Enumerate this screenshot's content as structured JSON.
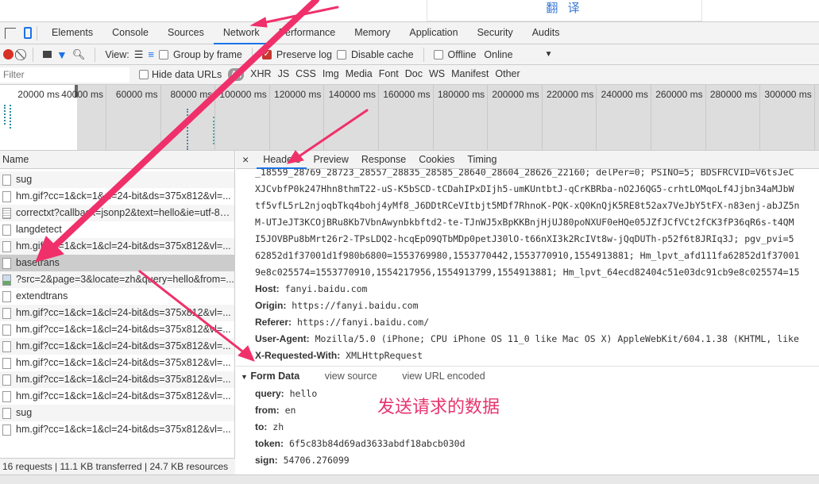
{
  "page": {
    "translate_button": "翻 译"
  },
  "tabs": [
    "Elements",
    "Console",
    "Sources",
    "Network",
    "Performance",
    "Memory",
    "Application",
    "Security",
    "Audits"
  ],
  "active_tab": "Network",
  "toolbar": {
    "view_label": "View:",
    "group_by_frame": "Group by frame",
    "preserve_log": "Preserve log",
    "disable_cache": "Disable cache",
    "offline": "Offline",
    "throttle": "Online"
  },
  "filterbar": {
    "placeholder": "Filter",
    "hide_data_urls": "Hide data URLs",
    "types": [
      "All",
      "XHR",
      "JS",
      "CSS",
      "Img",
      "Media",
      "Font",
      "Doc",
      "WS",
      "Manifest",
      "Other"
    ]
  },
  "overview": {
    "ticks": [
      "20000 ms",
      "40000 ms",
      "60000 ms",
      "80000 ms",
      "100000 ms",
      "120000 ms",
      "140000 ms",
      "160000 ms",
      "180000 ms",
      "200000 ms",
      "220000 ms",
      "240000 ms",
      "260000 ms",
      "280000 ms",
      "300000 ms",
      "3"
    ]
  },
  "requests": {
    "header": "Name",
    "items": [
      {
        "name": "sug",
        "icon": "file"
      },
      {
        "name": "hm.gif?cc=1&ck=1&cl=24-bit&ds=375x812&vl=...",
        "icon": "file"
      },
      {
        "name": "correctxt?callback=jsonp2&text=hello&ie=utf-8&...",
        "icon": "doc"
      },
      {
        "name": "langdetect",
        "icon": "file"
      },
      {
        "name": "hm.gif?cc=1&ck=1&cl=24-bit&ds=375x812&vl=...",
        "icon": "file"
      },
      {
        "name": "basetrans",
        "icon": "file",
        "selected": true
      },
      {
        "name": "?src=2&page=3&locate=zh&query=hello&from=...",
        "icon": "img"
      },
      {
        "name": "extendtrans",
        "icon": "file"
      },
      {
        "name": "hm.gif?cc=1&ck=1&cl=24-bit&ds=375x812&vl=...",
        "icon": "file"
      },
      {
        "name": "hm.gif?cc=1&ck=1&cl=24-bit&ds=375x812&vl=...",
        "icon": "file"
      },
      {
        "name": "hm.gif?cc=1&ck=1&cl=24-bit&ds=375x812&vl=...",
        "icon": "file"
      },
      {
        "name": "hm.gif?cc=1&ck=1&cl=24-bit&ds=375x812&vl=...",
        "icon": "file"
      },
      {
        "name": "hm.gif?cc=1&ck=1&cl=24-bit&ds=375x812&vl=...",
        "icon": "file"
      },
      {
        "name": "hm.gif?cc=1&ck=1&cl=24-bit&ds=375x812&vl=...",
        "icon": "file"
      },
      {
        "name": "sug",
        "icon": "file"
      },
      {
        "name": "hm.gif?cc=1&ck=1&cl=24-bit&ds=375x812&vl=...",
        "icon": "file"
      }
    ]
  },
  "status": "16 requests | 11.1 KB transferred | 24.7 KB resources",
  "detail": {
    "close": "×",
    "tabs": [
      "Headers",
      "Preview",
      "Response",
      "Cookies",
      "Timing"
    ],
    "active_tab": "Headers",
    "cookie_lines": [
      "_18559_28769_28723_28557_28835_28585_28640_28604_28626_22160; delPer=0; PSINO=5; BDSFRCVID=V6tsJeC",
      "XJCvbfP0k247Hhn8thmT22-uS-K5bSCD-tCDahIPxDIjh5-umKUntbtJ-qCrKBRba-nO2J6QG5-crhtLOMqoLf4Jjbn34aMJbW",
      "tf5vfL5rL2njoqbTkq4bohj4yMf8_J6DDtRCeVItbjt5MDf7RhnoK-PQK-xQ0KnQjK5RE8t52ax7VeJbY5tFX-n83enj-abJZ5n",
      "M-UTJeJT3KCOjBRu8Kb7VbnAwynbkbftd2-te-TJnWJ5xBpKKBnjHjUJ80poNXUF0eHQe05JZfJCfVCt2fCK3fP36qR6s-t4QM",
      "I5JOVBPu8bMrt26r2-TPsLDQ2-hcqEpO9QTbMDp0petJ30lO-t66nXI3k2RcIVt8w-jQqDUTh-p52f6t8JRIq3J; pgv_pvi=5",
      "62852d1f37001d1f980b6800=1553769980,1553770442,1553770910,1554913881; Hm_lpvt_afd111fa62852d1f37001",
      "9e8c025574=1553770910,1554217956,1554913799,1554913881; Hm_lpvt_64ecd82404c51e03dc91cb9e8c025574=15"
    ],
    "headers": [
      {
        "k": "Host:",
        "v": "fanyi.baidu.com"
      },
      {
        "k": "Origin:",
        "v": "https://fanyi.baidu.com"
      },
      {
        "k": "Referer:",
        "v": "https://fanyi.baidu.com/"
      },
      {
        "k": "User-Agent:",
        "v": "Mozilla/5.0 (iPhone; CPU iPhone OS 11_0 like Mac OS X) AppleWebKit/604.1.38 (KHTML, like"
      },
      {
        "k": "X-Requested-With:",
        "v": "XMLHttpRequest"
      }
    ],
    "form_data": {
      "title": "Form Data",
      "view_source": "view source",
      "view_url_encoded": "view URL encoded",
      "fields": [
        {
          "k": "query:",
          "v": "hello"
        },
        {
          "k": "from:",
          "v": "en"
        },
        {
          "k": "to:",
          "v": "zh"
        },
        {
          "k": "token:",
          "v": "6f5c83b84d69ad3633abdf18abcb030d"
        },
        {
          "k": "sign:",
          "v": "54706.276099"
        }
      ]
    }
  },
  "annotation": "发送请求的数据",
  "colors": {
    "accent": "#1a73e8",
    "annotation": "#e8336e",
    "record": "#d93025"
  }
}
